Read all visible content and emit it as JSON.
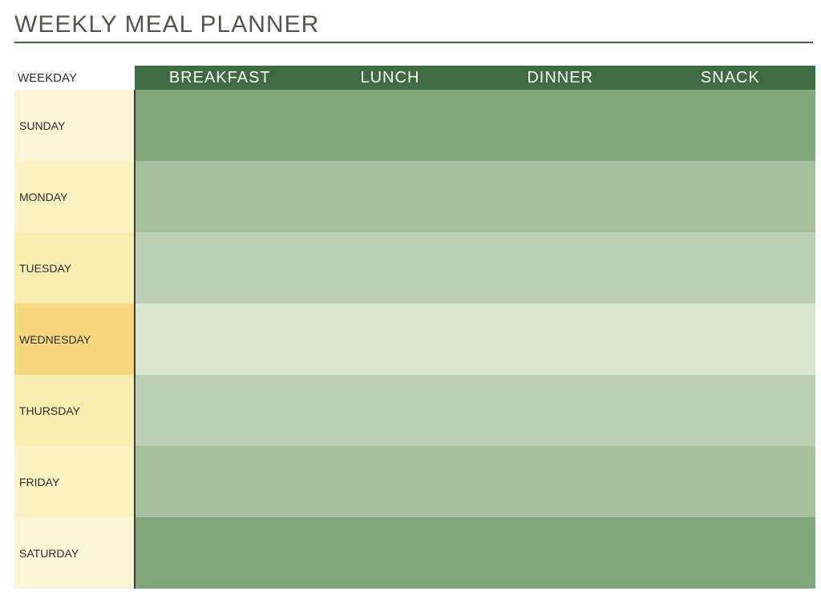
{
  "title": "WEEKLY MEAL PLANNER",
  "corner_label": "WEEKDAY",
  "meals": [
    "BREAKFAST",
    "LUNCH",
    "DINNER",
    "SNACK"
  ],
  "days": [
    {
      "key": "sun",
      "label": "SUNDAY",
      "breakfast": "",
      "lunch": "",
      "dinner": "",
      "snack": ""
    },
    {
      "key": "mon",
      "label": "MONDAY",
      "breakfast": "",
      "lunch": "",
      "dinner": "",
      "snack": ""
    },
    {
      "key": "tue",
      "label": "TUESDAY",
      "breakfast": "",
      "lunch": "",
      "dinner": "",
      "snack": ""
    },
    {
      "key": "wed",
      "label": "WEDNESDAY",
      "breakfast": "",
      "lunch": "",
      "dinner": "",
      "snack": ""
    },
    {
      "key": "thu",
      "label": "THURSDAY",
      "breakfast": "",
      "lunch": "",
      "dinner": "",
      "snack": ""
    },
    {
      "key": "fri",
      "label": "FRIDAY",
      "breakfast": "",
      "lunch": "",
      "dinner": "",
      "snack": ""
    },
    {
      "key": "sat",
      "label": "SATURDAY",
      "breakfast": "",
      "lunch": "",
      "dinner": "",
      "snack": ""
    }
  ]
}
